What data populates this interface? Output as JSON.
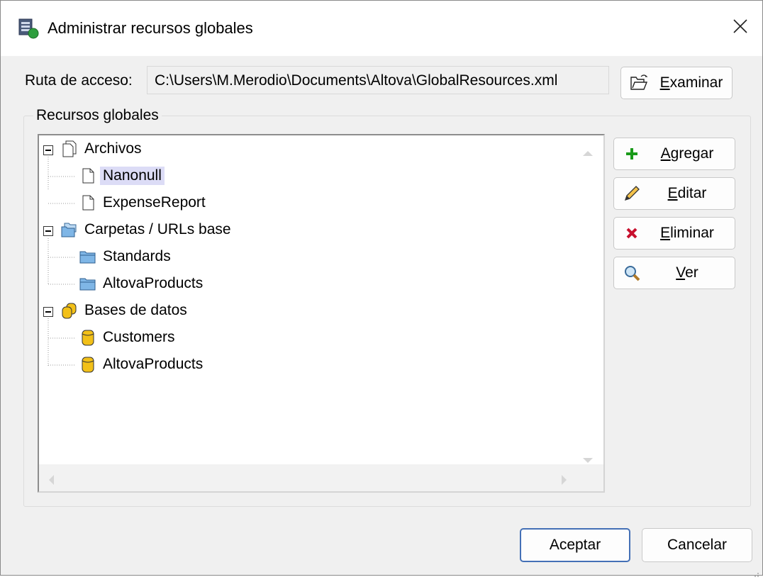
{
  "window": {
    "title": "Administrar recursos globales",
    "icon": "global-resources-icon",
    "close_icon": "close-icon"
  },
  "path": {
    "label": "Ruta de acceso:",
    "value": "C:\\Users\\M.Merodio\\Documents\\Altova\\GlobalResources.xml",
    "browse_button": {
      "mnemonic": "E",
      "rest": "xaminar",
      "icon": "open-folder-icon"
    }
  },
  "group": {
    "title": "Recursos globales"
  },
  "tree": {
    "categories": [
      {
        "label": "Archivos",
        "icon": "files-icon",
        "expanded": true,
        "children": [
          {
            "label": "Nanonull",
            "icon": "file-icon",
            "selected": true
          },
          {
            "label": "ExpenseReport",
            "icon": "file-icon",
            "selected": false
          }
        ]
      },
      {
        "label": "Carpetas / URLs base",
        "icon": "folders-icon",
        "expanded": true,
        "children": [
          {
            "label": "Standards",
            "icon": "folder-icon",
            "selected": false
          },
          {
            "label": "AltovaProducts",
            "icon": "folder-icon",
            "selected": false
          }
        ]
      },
      {
        "label": "Bases de datos",
        "icon": "databases-icon",
        "expanded": true,
        "children": [
          {
            "label": "Customers",
            "icon": "database-icon",
            "selected": false
          },
          {
            "label": "AltovaProducts",
            "icon": "database-icon",
            "selected": false
          }
        ]
      }
    ]
  },
  "actions": {
    "add": {
      "mnemonic": "A",
      "rest": "gregar",
      "icon": "plus-icon",
      "color": "#1a9b1a"
    },
    "edit": {
      "mnemonic": "E",
      "rest": "ditar",
      "icon": "pencil-icon"
    },
    "delete": {
      "mnemonic": "E",
      "rest": "liminar",
      "icon": "delete-x-icon",
      "color": "#c8102e"
    },
    "view": {
      "mnemonic": "V",
      "rest": "er",
      "icon": "magnifier-icon"
    }
  },
  "footer": {
    "ok_label": "Aceptar",
    "cancel_label": "Cancelar"
  },
  "colors": {
    "dialog_bg": "#f0f0f0",
    "selection_bg": "#dcdcf6",
    "default_button_border": "#4470b6",
    "folder_blue": "#7fb6e6",
    "database_yellow": "#f2c018"
  }
}
